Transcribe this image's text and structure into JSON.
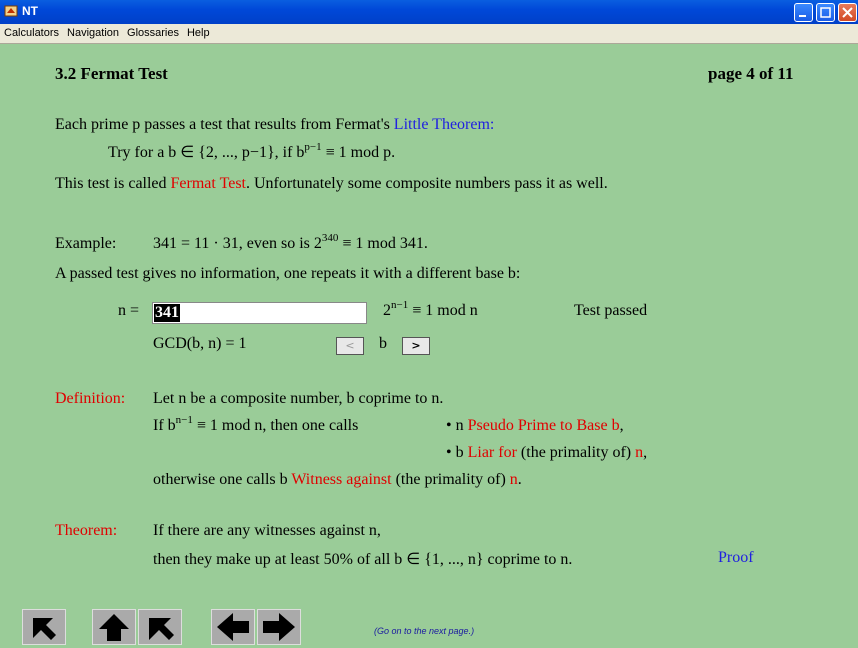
{
  "window": {
    "title": "NT"
  },
  "menu": [
    "Calculators",
    "Navigation",
    "Glossaries",
    "Help"
  ],
  "header": {
    "section": "3.2 Fermat Test",
    "page": "page 4 of 11"
  },
  "intro": {
    "line1_a": "Each prime p passes a test that results from Fermat's ",
    "line1_link": "Little Theorem:",
    "line2_a": "Try for a b ∈ {2, ..., p−1}, if  b",
    "line2_sup": "p−1",
    "line2_b": " ≡ 1 mod p.",
    "line3_a": "This test is called ",
    "line3_red": "Fermat Test",
    "line3_b": ". Unfortunately some composite numbers pass it as well."
  },
  "example": {
    "label": "Example:",
    "text_a": "341 = 11 · 31,  even so is  2",
    "sup": "340",
    "text_b": " ≡ 1 mod 341.",
    "line2": "A passed test gives no information, one repeats it with a different base b:"
  },
  "calc": {
    "n_label": "n =",
    "n_value": "341",
    "formula_a": "2",
    "formula_sup": "n−1",
    "formula_b": " ≡ 1 mod n",
    "result": "Test passed",
    "gcd": "GCD(b, n) = 1",
    "prev": "<",
    "b_label": "b",
    "next": ">"
  },
  "definition": {
    "label": "Definition:",
    "line1": "Let n be a composite number, b coprime to n.",
    "line2_a": "If  b",
    "line2_sup": "n−1",
    "line2_b": " ≡ 1 mod n,  then one calls",
    "bullet1_a": "•  n ",
    "bullet1_red": "Pseudo Prime to Base b",
    "bullet1_b": ",",
    "bullet2_a": "•  b ",
    "bullet2_red": "Liar for",
    "bullet2_b": " (the primality of) ",
    "bullet2_red2": "n",
    "bullet2_c": ",",
    "line4_a": "otherwise one calls b ",
    "line4_red": "Witness against",
    "line4_b": " (the primality of) ",
    "line4_red2": "n",
    "line4_c": "."
  },
  "theorem": {
    "label": "Theorem:",
    "line1": "If there are any witnesses against n,",
    "line2": "then they make up at least 50% of all b ∈ {1, ..., n} coprime to n.",
    "proof": "Proof"
  },
  "footer": {
    "hint": "(Go on to the next page.)"
  },
  "colors": {
    "background": "#9acc98",
    "accent_red": "#e00000",
    "link_blue": "#2020e0"
  }
}
